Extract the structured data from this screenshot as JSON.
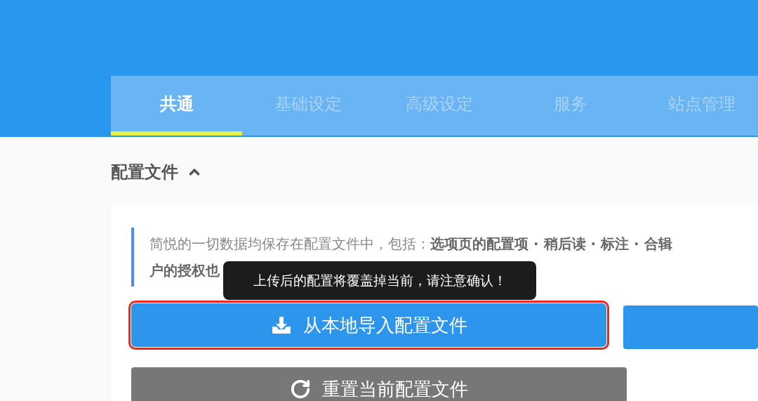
{
  "tabs": [
    {
      "label": "共通",
      "selected": true
    },
    {
      "label": "基础设定",
      "selected": false
    },
    {
      "label": "高级设定",
      "selected": false
    },
    {
      "label": "服务",
      "selected": false
    },
    {
      "label": "站点管理",
      "selected": false
    }
  ],
  "section": {
    "title": "配置文件",
    "expanded": true
  },
  "notice": {
    "lines": [
      "简悦的一切数据均保存在配置文件中，包括：**选项页的配置项 · 稍后读 · 标注 · 合辑**",
      "**户的授权也**"
    ]
  },
  "tooltip": "上传后的配置将覆盖掉当前，请注意确认！",
  "buttons": [
    {
      "label": "从本地导入配置文件",
      "kind": "import",
      "highlighted": true
    },
    {
      "label": "重置当前配置文件",
      "kind": "reset",
      "highlighted": false
    }
  ]
}
